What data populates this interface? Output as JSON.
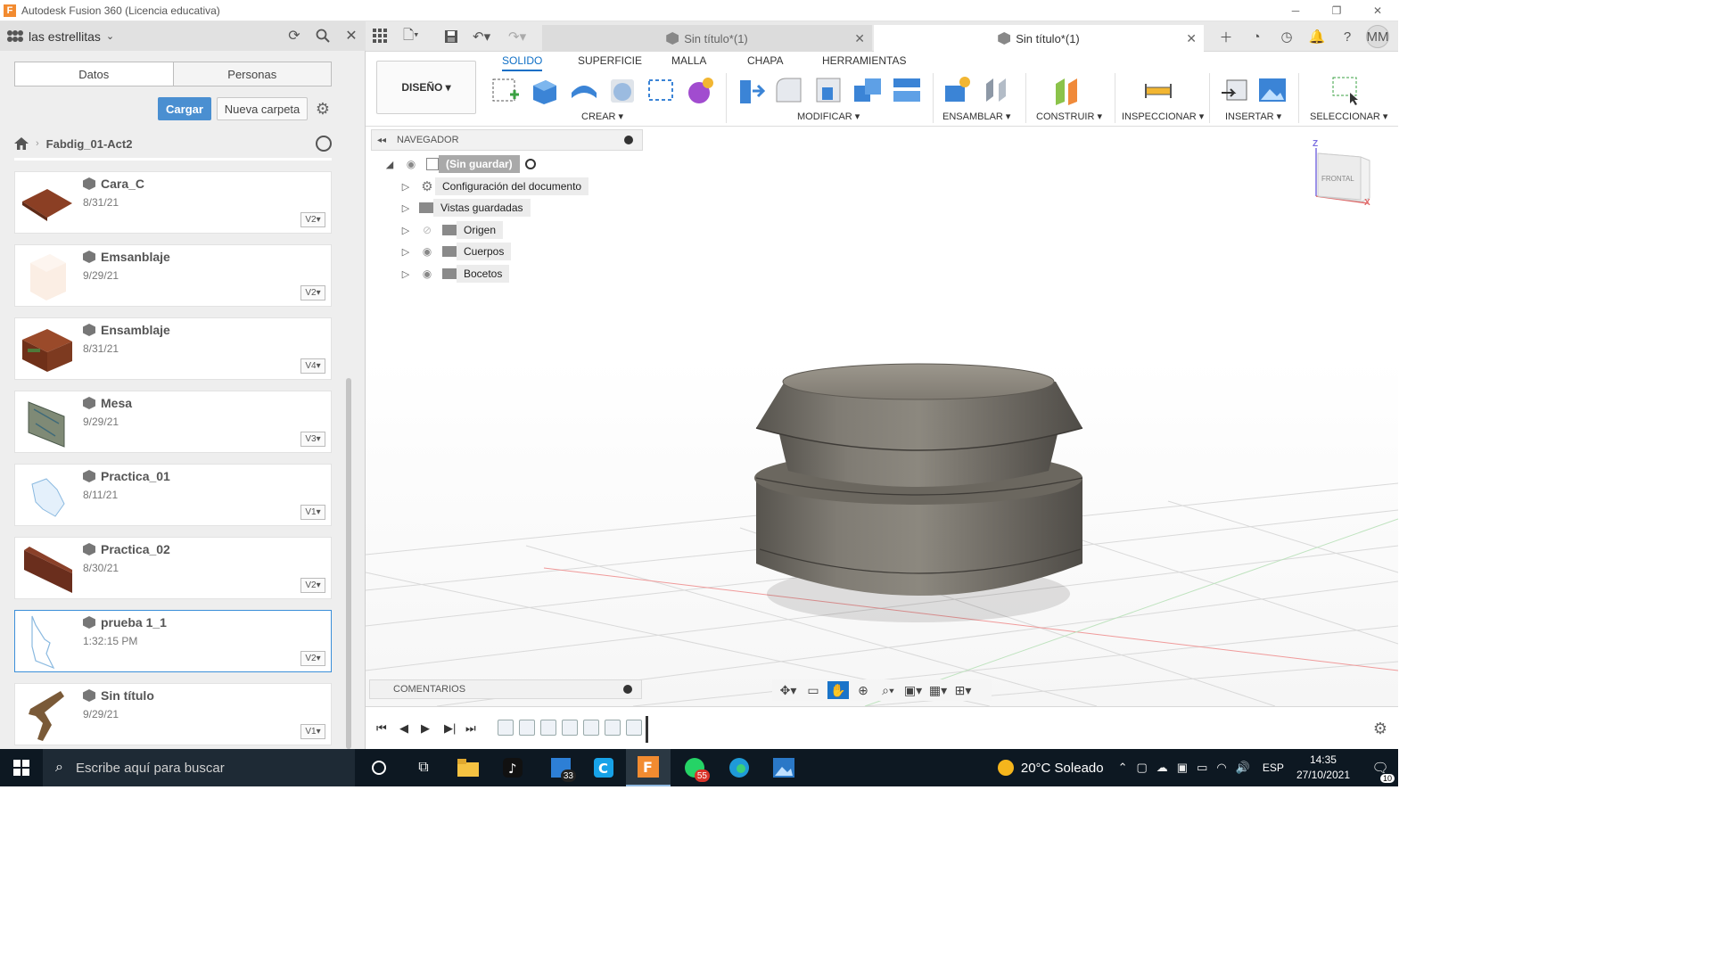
{
  "window": {
    "title": "Autodesk Fusion 360 (Licencia educativa)",
    "app_icon": "F",
    "controls": [
      "minimize",
      "restore",
      "close"
    ]
  },
  "data_panel": {
    "project_name": "las estrellitas",
    "segments": [
      "Datos",
      "Personas"
    ],
    "upload_label": "Cargar",
    "new_folder_label": "Nueva carpeta",
    "folder": "Fabdig_01-Act2",
    "files": [
      {
        "name": "Cara_C",
        "date": "8/31/21",
        "version": "V2▾",
        "thumb": "brown-plank"
      },
      {
        "name": "Emsanblaje",
        "date": "9/29/21",
        "version": "V2▾",
        "thumb": "beige-box"
      },
      {
        "name": "Ensamblaje",
        "date": "8/31/21",
        "version": "V4▾",
        "thumb": "brown-box"
      },
      {
        "name": "Mesa",
        "date": "9/29/21",
        "version": "V3▾",
        "thumb": "green-panel"
      },
      {
        "name": "Practica_01",
        "date": "8/11/21",
        "version": "V1▾",
        "thumb": "blue-sketch"
      },
      {
        "name": "Practica_02",
        "date": "8/30/21",
        "version": "V2▾",
        "thumb": "brown-slab"
      },
      {
        "name": "prueba 1_1",
        "date": "1:32:15 PM",
        "version": "V2▾",
        "thumb": "blue-outline",
        "selected": true
      },
      {
        "name": "Sin título",
        "date": "9/29/21",
        "version": "V1▾",
        "thumb": "brown-branch"
      }
    ]
  },
  "tabs": [
    {
      "label": "Sin título*(1)",
      "active": false
    },
    {
      "label": "Sin título*(1)",
      "active": true
    }
  ],
  "user_initials": "MM",
  "toolbar": {
    "workspace": "DISEÑO ▾",
    "ribbon_tabs": [
      "SOLIDO",
      "SUPERFICIE",
      "MALLA",
      "CHAPA",
      "HERRAMIENTAS"
    ],
    "active_tab": "SOLIDO",
    "groups": [
      "CREAR ▾",
      "MODIFICAR ▾",
      "ENSAMBLAR ▾",
      "CONSTRUIR ▾",
      "INSPECCIONAR ▾",
      "INSERTAR ▾",
      "SELECCIONAR ▾"
    ]
  },
  "navigator": {
    "title": "NAVEGADOR",
    "root": "(Sin guardar)",
    "items": [
      "Configuración del documento",
      "Vistas guardadas",
      "Origen",
      "Cuerpos",
      "Bocetos"
    ]
  },
  "viewcube": {
    "face": "FRONTAL",
    "axis_z": "Z",
    "axis_x": "X"
  },
  "comments_label": "COMENTARIOS",
  "taskbar": {
    "search_placeholder": "Escribe aquí para buscar",
    "badge_store": "33",
    "badge_whatsapp": "55",
    "weather": "20°C Soleado",
    "language": "ESP",
    "time": "14:35",
    "date": "27/10/2021",
    "notifications": "10"
  },
  "colors": {
    "accent": "#0f6fc6",
    "upload_button": "#4a8fd1",
    "taskbar": "#0d1822",
    "model": "#6f6b63"
  }
}
